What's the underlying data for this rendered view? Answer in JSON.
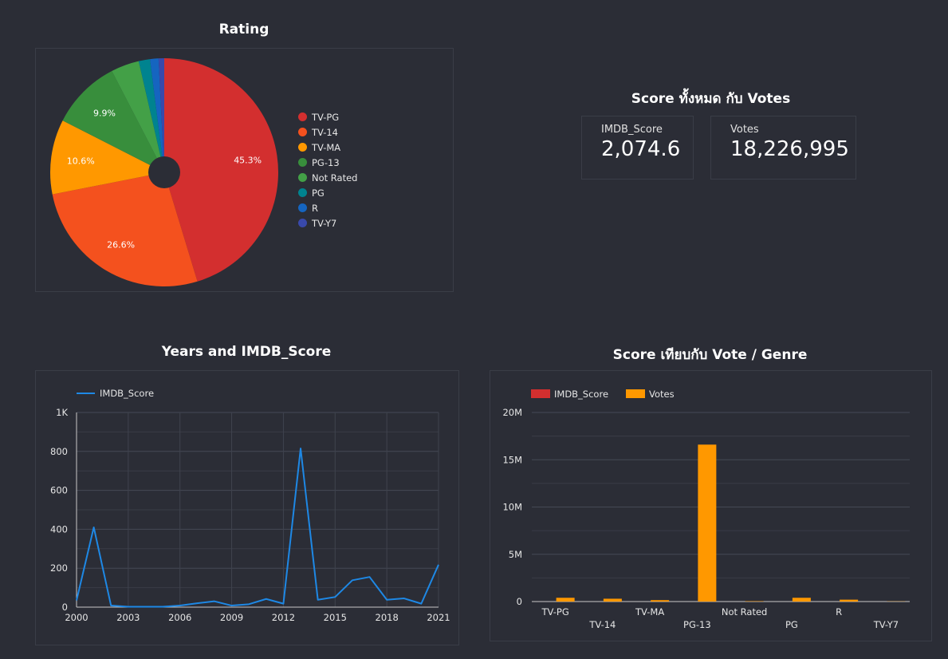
{
  "panels": {
    "rating_title": "Rating",
    "score_votes_title": "Score ทั้งหมด กับ Votes",
    "years_title": "Years and IMDB_Score",
    "genre_title": "Score เทียบกับ Vote / Genre"
  },
  "kpis": [
    {
      "label": "IMDB_Score",
      "value": "2,074.6"
    },
    {
      "label": "Votes",
      "value": "18,226,995"
    }
  ],
  "colors": {
    "background": "#2b2d36",
    "line": "#1e88e5",
    "imdb_bar": "#d32f2f",
    "votes_bar": "#ff9800"
  },
  "chart_data": [
    {
      "type": "pie",
      "title": "Rating",
      "donut": true,
      "legend_position": "right",
      "categories": [
        "TV-PG",
        "TV-14",
        "TV-MA",
        "PG-13",
        "Not Rated",
        "PG",
        "R",
        "TV-Y7"
      ],
      "values": [
        45.3,
        26.6,
        10.6,
        9.9,
        4.0,
        1.6,
        1.2,
        0.8
      ],
      "data_labels": [
        "45.3%",
        "26.6%",
        "10.6%",
        "9.9%",
        "",
        "",
        "",
        ""
      ],
      "colors": [
        "#d32f2f",
        "#f4511e",
        "#ff9800",
        "#388e3c",
        "#43a047",
        "#00838f",
        "#1565c0",
        "#3949ab"
      ]
    },
    {
      "type": "line",
      "title": "Years and IMDB_Score",
      "legend_position": "top-left",
      "series": [
        {
          "name": "IMDB_Score",
          "color": "#1e88e5",
          "x": [
            2000,
            2001,
            2002,
            2003,
            2004,
            2005,
            2006,
            2007,
            2008,
            2009,
            2010,
            2011,
            2012,
            2013,
            2014,
            2015,
            2016,
            2017,
            2018,
            2019,
            2020,
            2021
          ],
          "values": [
            35,
            410,
            8,
            2,
            2,
            2,
            8,
            20,
            30,
            8,
            15,
            42,
            18,
            815,
            38,
            52,
            138,
            155,
            38,
            45,
            18,
            218
          ]
        }
      ],
      "ylim": [
        0,
        1000
      ],
      "y_ticks": [
        0,
        200,
        400,
        600,
        800,
        1000
      ],
      "y_tick_labels": [
        "0",
        "200",
        "400",
        "600",
        "800",
        "1K"
      ],
      "x_ticks": [
        2000,
        2003,
        2006,
        2009,
        2012,
        2015,
        2018,
        2021
      ],
      "grid": true
    },
    {
      "type": "bar",
      "title": "Score เทียบกับ Vote / Genre",
      "legend_position": "top-left",
      "categories": [
        "TV-PG",
        "TV-14",
        "TV-MA",
        "PG-13",
        "Not Rated",
        "PG",
        "R",
        "TV-Y7"
      ],
      "series": [
        {
          "name": "IMDB_Score",
          "color": "#d32f2f",
          "values": [
            940,
            552,
            220,
            205,
            83,
            33,
            25,
            17
          ]
        },
        {
          "name": "Votes",
          "color": "#ff9800",
          "values": [
            400000,
            300000,
            150000,
            16600000,
            40000,
            400000,
            200000,
            20000
          ]
        }
      ],
      "ylim": [
        0,
        20000000
      ],
      "y_ticks": [
        0,
        5000000,
        10000000,
        15000000,
        20000000
      ],
      "y_tick_labels": [
        "0",
        "5M",
        "10M",
        "15M",
        "20M"
      ],
      "grid": true
    }
  ]
}
